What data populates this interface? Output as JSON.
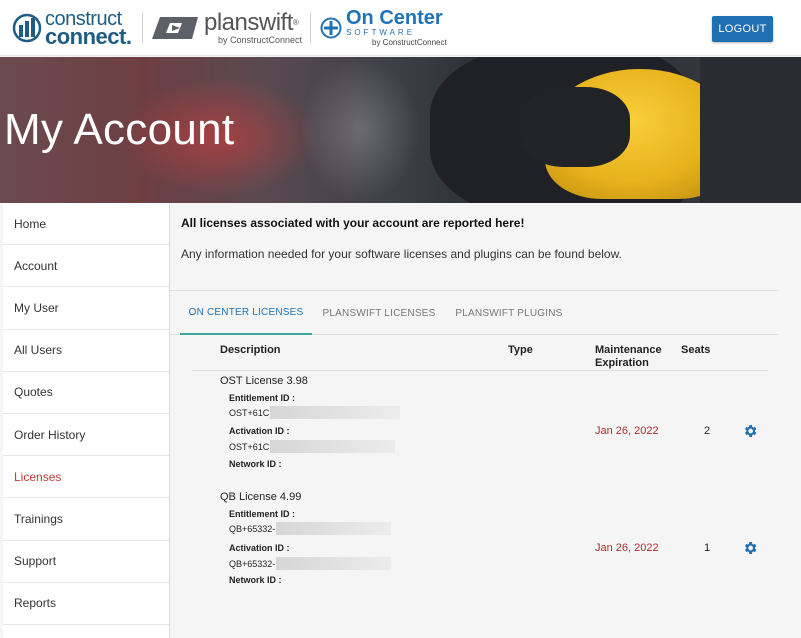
{
  "header": {
    "logos": {
      "constructconnect": {
        "line1": "construct",
        "line2": "connect.",
        "icon": "constructconnect-logo-icon"
      },
      "planswift": {
        "name": "planswift",
        "reg": "®",
        "byline": "by ConstructConnect",
        "icon": "planswift-logo-icon"
      },
      "oncenter": {
        "name": "On Center",
        "sub": "SOFTWARE",
        "byline": "by ConstructConnect",
        "icon": "oncenter-logo-icon"
      }
    },
    "logout_label": "LOGOUT",
    "accent_color": "#1f6fb2"
  },
  "hero": {
    "title": "My Account"
  },
  "sidebar": {
    "items": [
      {
        "label": "Home"
      },
      {
        "label": "Account"
      },
      {
        "label": "My User"
      },
      {
        "label": "All Users"
      },
      {
        "label": "Quotes"
      },
      {
        "label": "Order History"
      },
      {
        "label": "Licenses",
        "active": true
      },
      {
        "label": "Trainings"
      },
      {
        "label": "Support"
      },
      {
        "label": "Reports"
      }
    ],
    "active_color": "#c13b3b"
  },
  "main": {
    "intro_heading": "All licenses associated with your account are reported here!",
    "intro_text": "Any information needed for your software licenses and plugins can be found below.",
    "tabs": [
      {
        "label": "ON CENTER LICENSES",
        "active": true
      },
      {
        "label": "PLANSWIFT LICENSES"
      },
      {
        "label": "PLANSWIFT PLUGINS"
      }
    ],
    "table": {
      "headers": {
        "description": "Description",
        "type": "Type",
        "maintenance_line1": "Maintenance",
        "maintenance_line2": "Expiration",
        "seats": "Seats"
      },
      "rows": [
        {
          "name": "OST License 3.98",
          "entitlement_label": "Entitlement ID :",
          "entitlement_value": "OST+61C",
          "activation_label": "Activation ID :",
          "activation_value": "OST+61C",
          "network_label": "Network ID :",
          "type": "",
          "expiration": "Jan 26, 2022",
          "seats": "2",
          "action_icon": "gear-icon"
        },
        {
          "name": "QB License 4.99",
          "entitlement_label": "Entitlement ID :",
          "entitlement_value": "QB+65332-",
          "activation_label": "Activation ID :",
          "activation_value": "QB+65332-",
          "network_label": "Network ID :",
          "type": "",
          "expiration": "Jan 26, 2022",
          "seats": "1",
          "action_icon": "gear-icon"
        }
      ]
    },
    "expiration_color": "#b22d2d",
    "tab_active_color": "#1f73b7"
  }
}
